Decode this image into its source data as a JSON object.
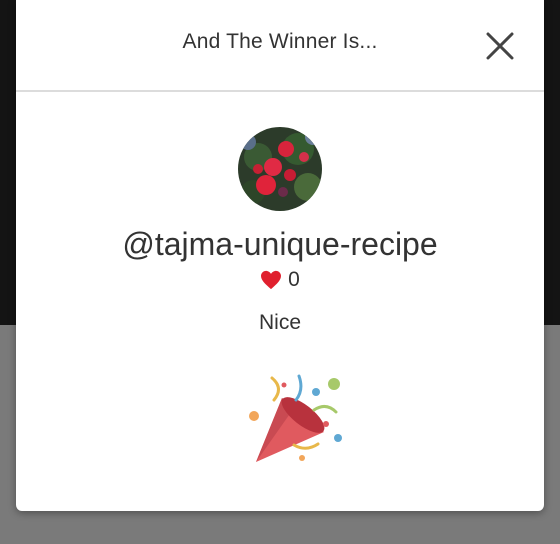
{
  "modal": {
    "title": "And The Winner Is...",
    "close_icon": "close-icon"
  },
  "winner": {
    "avatar_icon": "avatar-rose-photo",
    "username": "@tajma-unique-recipe",
    "like_icon": "heart-icon",
    "like_color": "#e0202e",
    "likes": "0",
    "message": "Nice"
  },
  "celebration_icon": "party-popper-icon"
}
